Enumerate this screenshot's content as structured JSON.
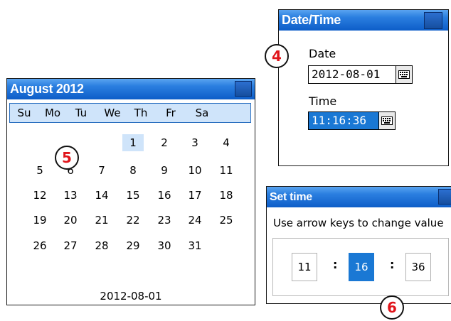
{
  "calendar_window": {
    "title": "August 2012",
    "weekdays": [
      "Su",
      "Mo",
      "Tu",
      "We",
      "Th",
      "Fr",
      "Sa"
    ],
    "weeks": [
      [
        "",
        "",
        "",
        "1",
        "2",
        "3",
        "4"
      ],
      [
        "5",
        "6",
        "7",
        "8",
        "9",
        "10",
        "11"
      ],
      [
        "12",
        "13",
        "14",
        "15",
        "16",
        "17",
        "18"
      ],
      [
        "19",
        "20",
        "21",
        "22",
        "23",
        "24",
        "25"
      ],
      [
        "26",
        "27",
        "28",
        "29",
        "30",
        "31",
        ""
      ]
    ],
    "selected_day": "1",
    "footer_date": "2012-08-01"
  },
  "datetime_window": {
    "title": "Date/Time",
    "date_label": "Date",
    "date_value": "2012-08-01",
    "time_label": "Time",
    "time_value": "11:16:36"
  },
  "settime_window": {
    "title": "Set time",
    "hint": "Use arrow keys to change value",
    "hours": "11",
    "minutes": "16",
    "seconds": "36",
    "separator": ":",
    "active_field": "minutes"
  },
  "markers": {
    "m4": "4",
    "m5": "5",
    "m6": "6"
  },
  "colors": {
    "titlebar": "#0d5dc8",
    "selection": "#1a78d4",
    "highlight": "#cfe4fa",
    "marker_text": "#e0151b"
  }
}
